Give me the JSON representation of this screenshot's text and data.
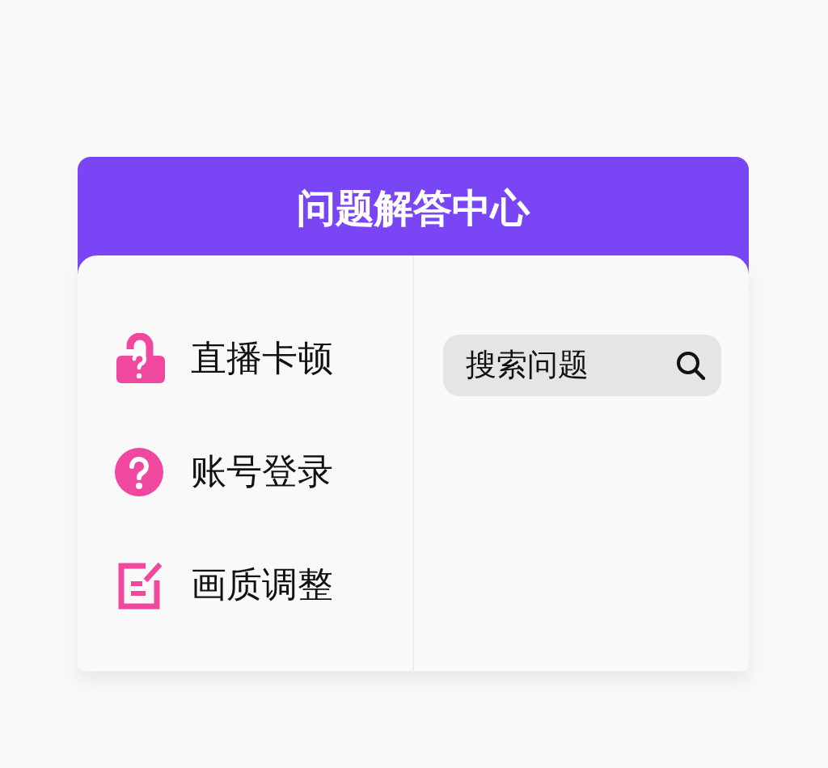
{
  "header": {
    "title": "问题解答中心"
  },
  "topics": [
    {
      "kind": "lock",
      "label": "直播卡顿"
    },
    {
      "kind": "question",
      "label": "账号登录"
    },
    {
      "kind": "edit",
      "label": "画质调整"
    }
  ],
  "search": {
    "placeholder": "搜索问题"
  }
}
